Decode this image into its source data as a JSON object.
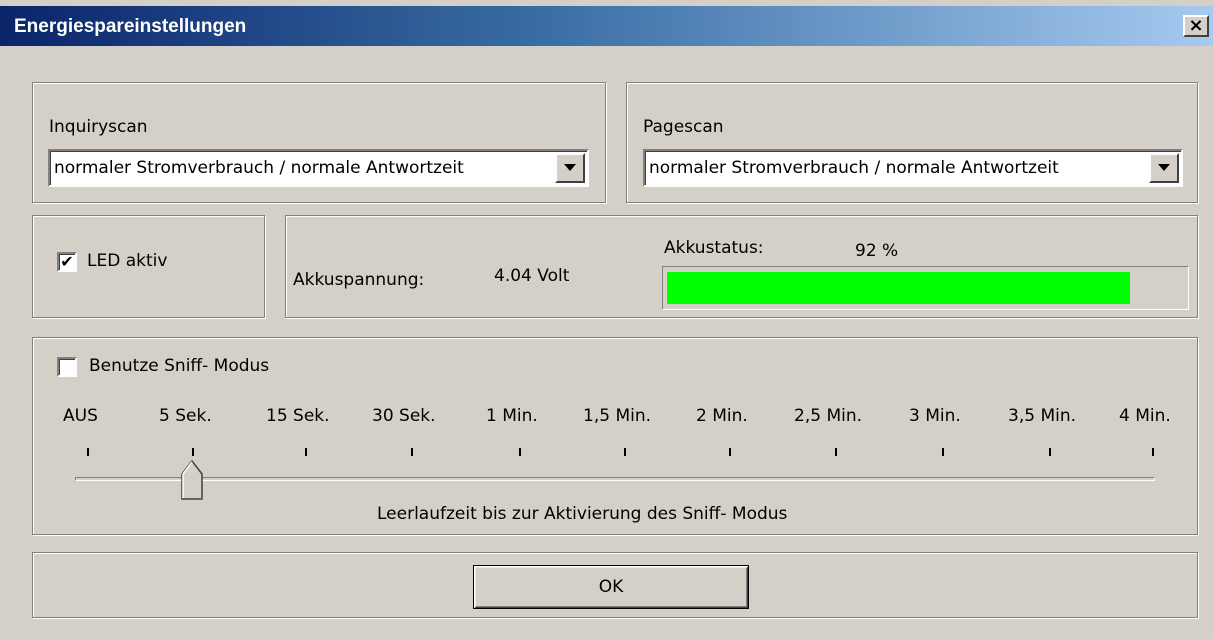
{
  "window": {
    "title": "Energiespareinstellungen",
    "close_label": "×"
  },
  "inquiryscan": {
    "label": "Inquiryscan",
    "value": "normaler Stromverbrauch / normale Antwortzeit"
  },
  "pagescan": {
    "label": "Pagescan",
    "value": "normaler Stromverbrauch / normale Antwortzeit"
  },
  "led": {
    "label": "LED aktiv",
    "checked": true,
    "check_glyph": "✔"
  },
  "battery": {
    "voltage_label": "Akkuspannung:",
    "voltage_value": "4.04 Volt",
    "status_label": "Akkustatus:",
    "status_value": "92 %",
    "status_fraction": 0.92,
    "bar_color": "#00ff00"
  },
  "sniff": {
    "checkbox_label": "Benutze Sniff- Modus",
    "checked": false,
    "ticks": [
      "AUS",
      "5 Sek.",
      "15 Sek.",
      "30 Sek.",
      "1 Min.",
      "1,5 Min.",
      "2 Min.",
      "2,5 Min.",
      "3 Min.",
      "3,5 Min.",
      "4 Min."
    ],
    "selected_index": 1,
    "caption": "Leerlaufzeit bis zur Aktivierung des Sniff- Modus"
  },
  "footer": {
    "ok_label": "OK"
  }
}
